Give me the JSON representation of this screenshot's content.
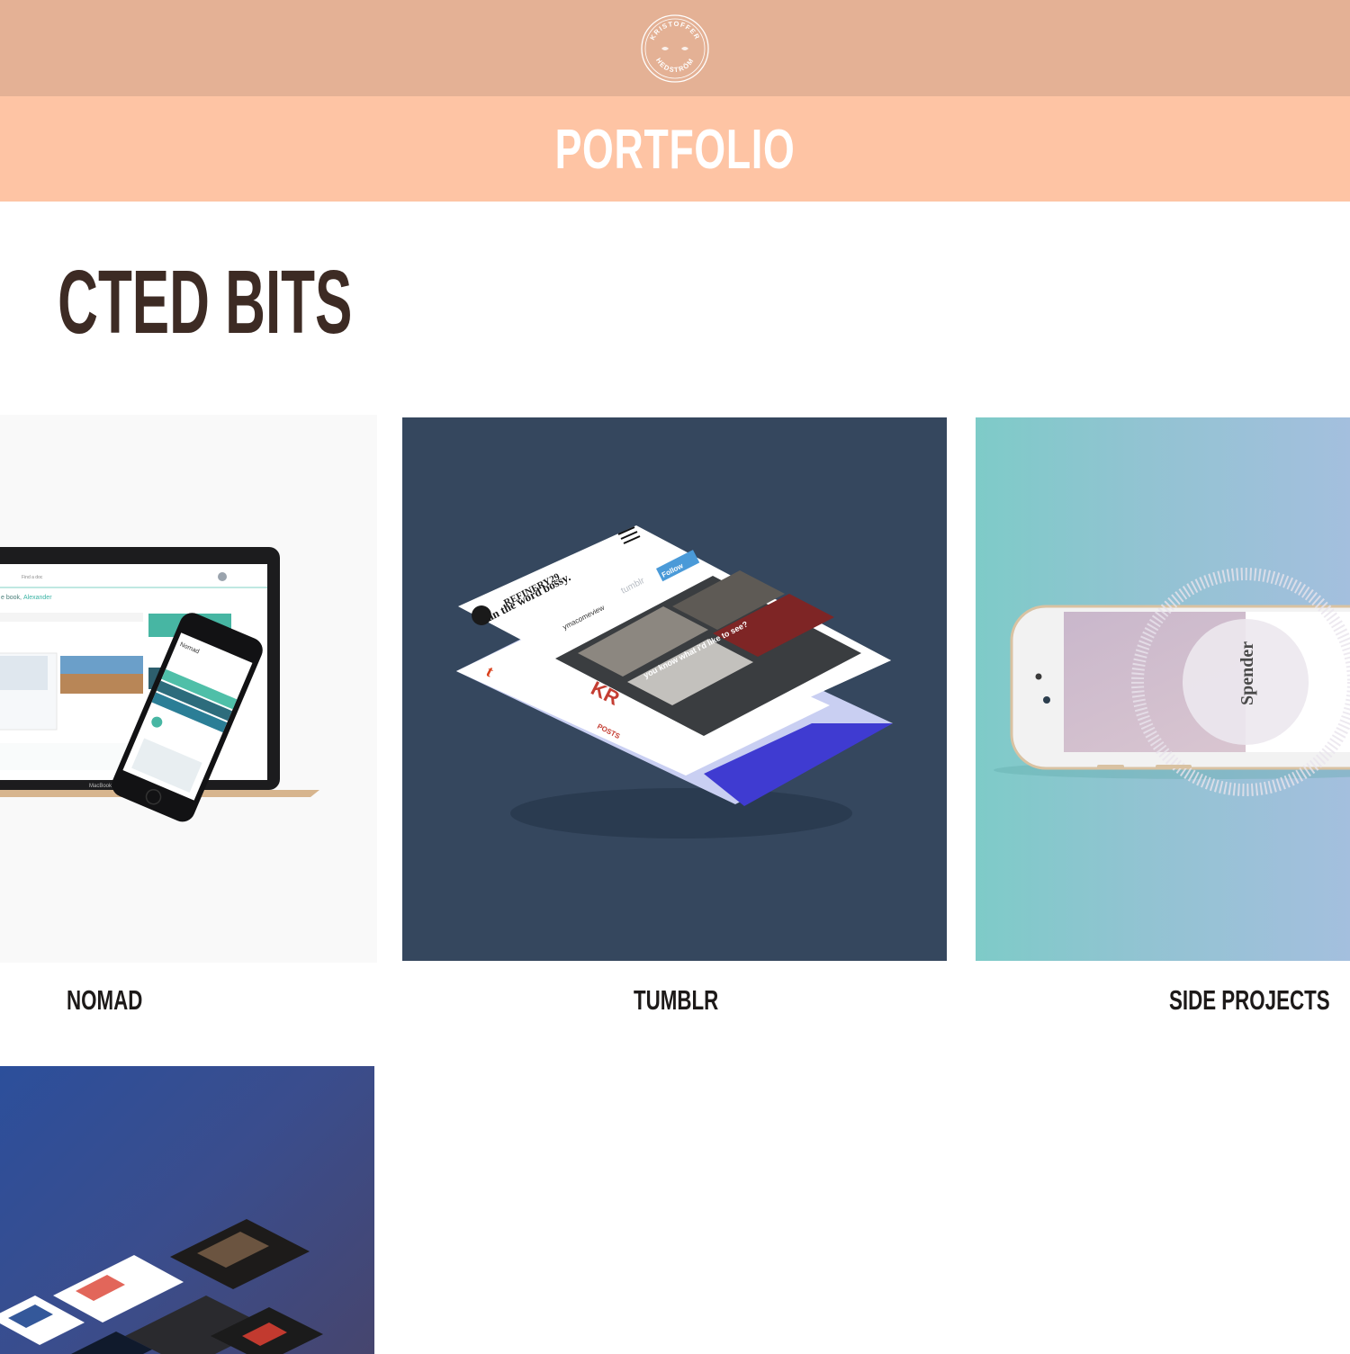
{
  "header": {
    "logo_icon": "circular-stamp-logo",
    "logo_text_top": "KRISTOFFER",
    "logo_text_bottom": "HEDSTRÖM",
    "title": "PORTFOLIO"
  },
  "section": {
    "heading": "CTED BITS"
  },
  "colors": {
    "topbar": "#e4b195",
    "titlebar": "#fec4a4",
    "heading": "#3d2b24",
    "tumblr_card": "#35475e"
  },
  "cards": [
    {
      "label": "NOMAD",
      "thumbnail": {
        "device_caption": "MacBook",
        "phone_header": "Nomad",
        "search_placeholder": "Find a doc",
        "greeting_prefix": "e book,",
        "greeting_name": "Alexander"
      }
    },
    {
      "label": "TUMBLR",
      "thumbnail": {
        "brand": "REFINERY29",
        "headline": "ban the word bossy.",
        "follow": "Follow",
        "tumblr_word": "tumblr",
        "username": "ymacomeview",
        "caption": "you know what i'd like to see?",
        "posts": "POSTS"
      }
    },
    {
      "label": "SIDE PROJECTS",
      "thumbnail": {
        "app_name": "Spender"
      }
    },
    {
      "label": "",
      "thumbnail": {}
    }
  ]
}
